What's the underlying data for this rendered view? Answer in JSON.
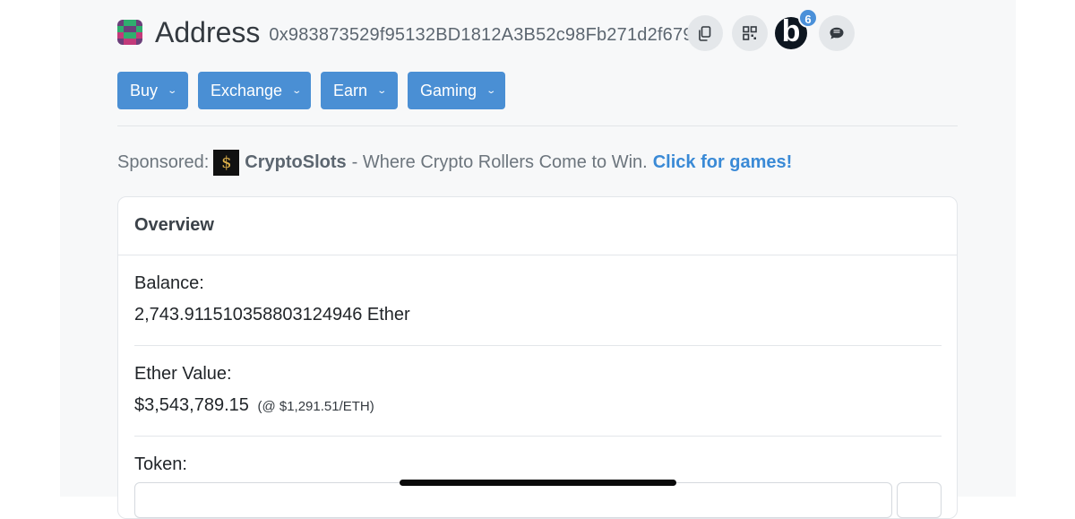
{
  "address": {
    "title": "Address",
    "hash": "0x983873529f95132BD1812A3B52c98Fb271d2f679"
  },
  "toolbar": {
    "copy_icon": "copy-icon",
    "qr_icon": "qr-code-icon",
    "blockscan_label": "b",
    "blockscan_badge": "6",
    "chat_icon": "chat-icon"
  },
  "menu": [
    {
      "label": "Buy"
    },
    {
      "label": "Exchange"
    },
    {
      "label": "Earn"
    },
    {
      "label": "Gaming"
    }
  ],
  "sponsored": {
    "prefix": "Sponsored:",
    "name": "CryptoSlots",
    "tagline": "- Where Crypto Rollers Come to Win.",
    "link": "Click for games!"
  },
  "overview": {
    "header": "Overview",
    "balance_label": "Balance:",
    "balance_value": "2,743.911510358803124946 Ether",
    "ether_value_label": "Ether Value:",
    "ether_value": "$3,543,789.15",
    "ether_price": "(@ $1,291.51/ETH)",
    "token_label": "Token:"
  },
  "colors": {
    "accent": "#4a8fd4",
    "link": "#3a8ad6",
    "badge": "#4a90d9"
  }
}
